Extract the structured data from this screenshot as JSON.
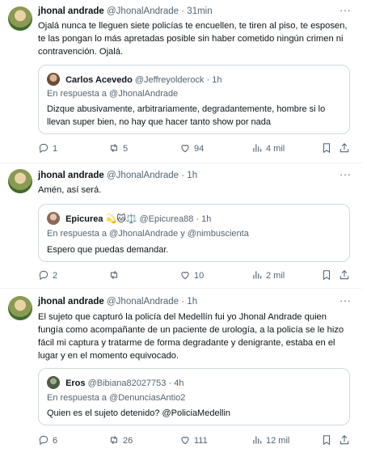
{
  "tweets": [
    {
      "name": "jhonal andrade",
      "handle": "@JhonalAndrade",
      "dot": "·",
      "time": "31min",
      "text": "Ojalá nunca te lleguen siete policías te encuellen, te tiren al piso, te esposen, te las pongan lo más apretadas posible sin haber cometido ningún crimen ni contravención. Ojalá.",
      "quote": {
        "name": "Carlos Acevedo",
        "handle": "@Jeffreyolderock",
        "dot": "·",
        "time": "1h",
        "reply_to": "En respuesta a @JhonalAndrade",
        "text": "Dizque abusivamente, arbitrariamente, degradantemente, hombre si lo llevan super bien, no hay que hacer tanto show por nada"
      },
      "stats": {
        "replies": "1",
        "reposts": "5",
        "likes": "94",
        "views": "4 mil"
      }
    },
    {
      "name": "jhonal andrade",
      "handle": "@JhonalAndrade",
      "dot": "·",
      "time": "1h",
      "text": "Amén, así será.",
      "quote": {
        "name": "Epicurea 💫🐱⚖️",
        "handle": "@Epicurea88",
        "dot": "·",
        "time": "1h",
        "reply_to": "En respuesta a @JhonalAndrade y @nimbuscienta",
        "text": "Espero que puedas demandar."
      },
      "stats": {
        "replies": "2",
        "reposts": "",
        "likes": "10",
        "views": "2 mil"
      }
    },
    {
      "name": "jhonal andrade",
      "handle": "@JhonalAndrade",
      "dot": "·",
      "time": "1h",
      "text": "El sujeto que capturó la policía del Medellín fui yo Jhonal Andrade quien fungía como acompañante de un paciente de urología, a la policía se le hizo fácil mi captura y tratarme de forma degradante y denigrante, estaba en el lugar y en el momento equivocado.",
      "quote": {
        "name": "Eros",
        "handle": "@Bibiana82027753",
        "dot": "·",
        "time": "4h",
        "reply_to": "En respuesta a @DenunciasAntio2",
        "text": "Quien es el sujeto detenido? @PoliciaMedellin"
      },
      "stats": {
        "replies": "6",
        "reposts": "26",
        "likes": "111",
        "views": "12 mil"
      }
    }
  ],
  "more_glyph": "···",
  "colors": {
    "text": "#0f1419",
    "muted": "#536471",
    "border": "#cfd9de",
    "divider": "#eff3f4"
  },
  "icons": [
    "reply-icon",
    "repost-icon",
    "like-icon",
    "views-icon",
    "bookmark-icon",
    "share-icon",
    "more-icon"
  ]
}
